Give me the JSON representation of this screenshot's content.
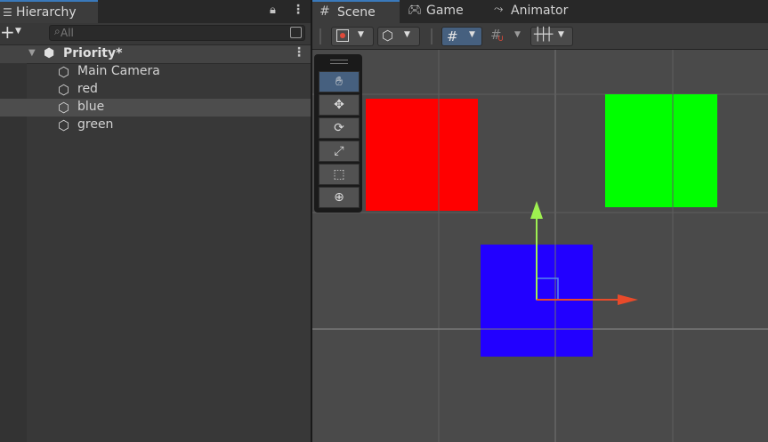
{
  "hierarchy": {
    "tab_label": "Hierarchy",
    "search_placeholder": "All",
    "scene_name": "Priority*",
    "items": [
      {
        "label": "Main Camera"
      },
      {
        "label": "red"
      },
      {
        "label": "blue"
      },
      {
        "label": "green"
      }
    ]
  },
  "scene_view": {
    "tabs": [
      {
        "label": "Scene"
      },
      {
        "label": "Game"
      },
      {
        "label": "Animator"
      }
    ]
  },
  "colors": {
    "red_square": "#ff0000",
    "green_square": "#00ff00",
    "blue_square": "#2200ff",
    "accent": "#3a79bb"
  },
  "icons": [
    "hamburger-icon",
    "lock-icon",
    "kebab-icon",
    "plus-icon",
    "chevron-down-icon",
    "search-icon",
    "unity-scene-icon",
    "cube-icon",
    "grid-icon",
    "gamepad-icon",
    "animator-icon",
    "hand-tool-icon",
    "move-tool-icon",
    "rotate-tool-icon",
    "scale-tool-icon",
    "rect-tool-icon",
    "transform-tool-icon",
    "gizmo-icon"
  ]
}
